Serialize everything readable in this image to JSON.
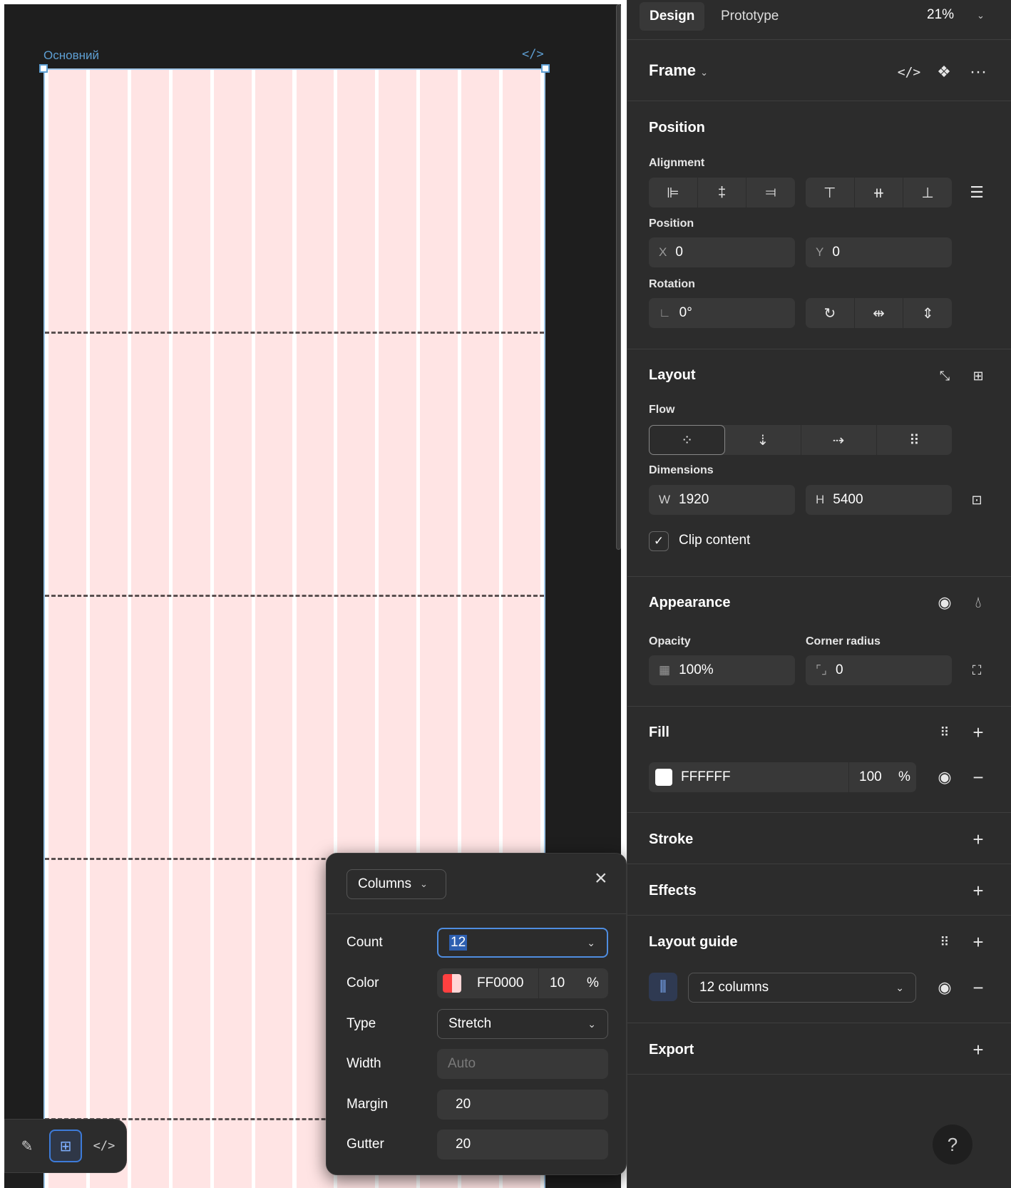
{
  "canvas": {
    "frame_label": "Основний",
    "code_icon": "</>",
    "column_count": 12,
    "column_color": "#ffe4e4"
  },
  "toolbar": {
    "tools": [
      {
        "name": "draw-tool-button",
        "icon": "pen-icon",
        "glyph": "✎",
        "active": false
      },
      {
        "name": "layout-tool-button",
        "icon": "layout-grid-icon",
        "glyph": "⊞",
        "active": true
      },
      {
        "name": "code-tool-button",
        "icon": "code-icon",
        "glyph": "</>",
        "active": false
      }
    ]
  },
  "grid_popover": {
    "type_label": "Columns",
    "fields": {
      "count": {
        "label": "Count",
        "value": "12"
      },
      "color": {
        "label": "Color",
        "hex": "FF0000",
        "opacity": "10",
        "unit": "%"
      },
      "type": {
        "label": "Type",
        "value": "Stretch"
      },
      "width": {
        "label": "Width",
        "value": "Auto"
      },
      "margin": {
        "label": "Margin",
        "value": "20"
      },
      "gutter": {
        "label": "Gutter",
        "value": "20"
      }
    }
  },
  "panel": {
    "tabs": [
      {
        "label": "Design",
        "active": true
      },
      {
        "label": "Prototype",
        "active": false
      }
    ],
    "zoom": "21%",
    "frame_title": "Frame",
    "position": {
      "title": "Position",
      "alignment_label": "Alignment",
      "position_label": "Position",
      "x_prefix": "X",
      "x_value": "0",
      "y_prefix": "Y",
      "y_value": "0",
      "rotation_label": "Rotation",
      "rotation_value": "0°"
    },
    "layout": {
      "title": "Layout",
      "flow_label": "Flow",
      "dimensions_label": "Dimensions",
      "w_prefix": "W",
      "w_value": "1920",
      "h_prefix": "H",
      "h_value": "5400",
      "clip_label": "Clip content",
      "clip_checked": true
    },
    "appearance": {
      "title": "Appearance",
      "opacity_label": "Opacity",
      "opacity_value": "100%",
      "radius_label": "Corner radius",
      "radius_value": "0"
    },
    "fill": {
      "title": "Fill",
      "hex": "FFFFFF",
      "opacity": "100",
      "unit": "%",
      "swatch": "#ffffff"
    },
    "stroke": {
      "title": "Stroke"
    },
    "effects": {
      "title": "Effects"
    },
    "layout_guide": {
      "title": "Layout guide",
      "value": "12 columns"
    },
    "export": {
      "title": "Export"
    },
    "help": "?"
  },
  "colors": {
    "accent": "#4f8de0",
    "panel_bg": "#2c2c2c",
    "canvas_bg": "#1e1e1e",
    "guide_red": "#ff0000"
  }
}
